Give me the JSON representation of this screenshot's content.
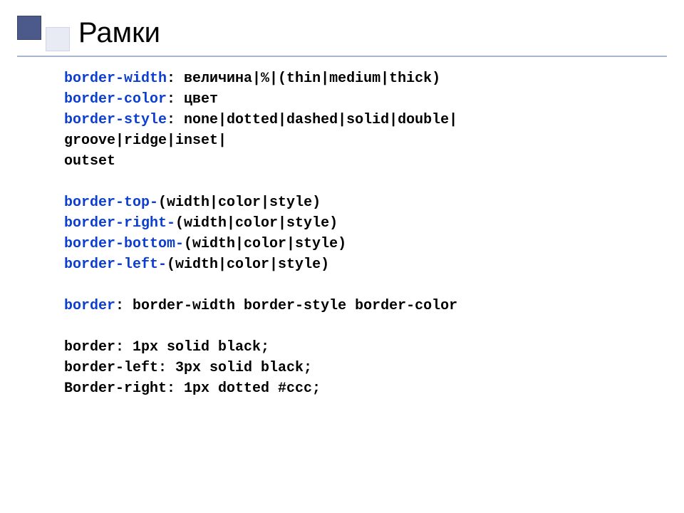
{
  "title": "Рамки",
  "lines": {
    "l1kw": "border-width",
    "l1rest": ": величина|%|(thin|medium|thick)",
    "l2kw": "border-color",
    "l2rest": ": цвет",
    "l3kw": "border-style",
    "l3rest": ": none|dotted|dashed|solid|double|",
    "l4": "groove|ridge|inset|",
    "l5": "outset",
    "l6kw": "border-top-",
    "l6rest": "(width|color|style)",
    "l7kw": "border-right-",
    "l7rest": "(width|color|style)",
    "l8kw": "border-bottom-",
    "l8rest": "(width|color|style)",
    "l9kw": "border-left-",
    "l9rest": "(width|color|style)",
    "l10kw": "border",
    "l10rest": ": border-width border-style border-color",
    "l11": "border: 1px solid black;",
    "l12": "border-left: 3px solid black;",
    "l13": "Border-right: 1px dotted #ccc;"
  }
}
